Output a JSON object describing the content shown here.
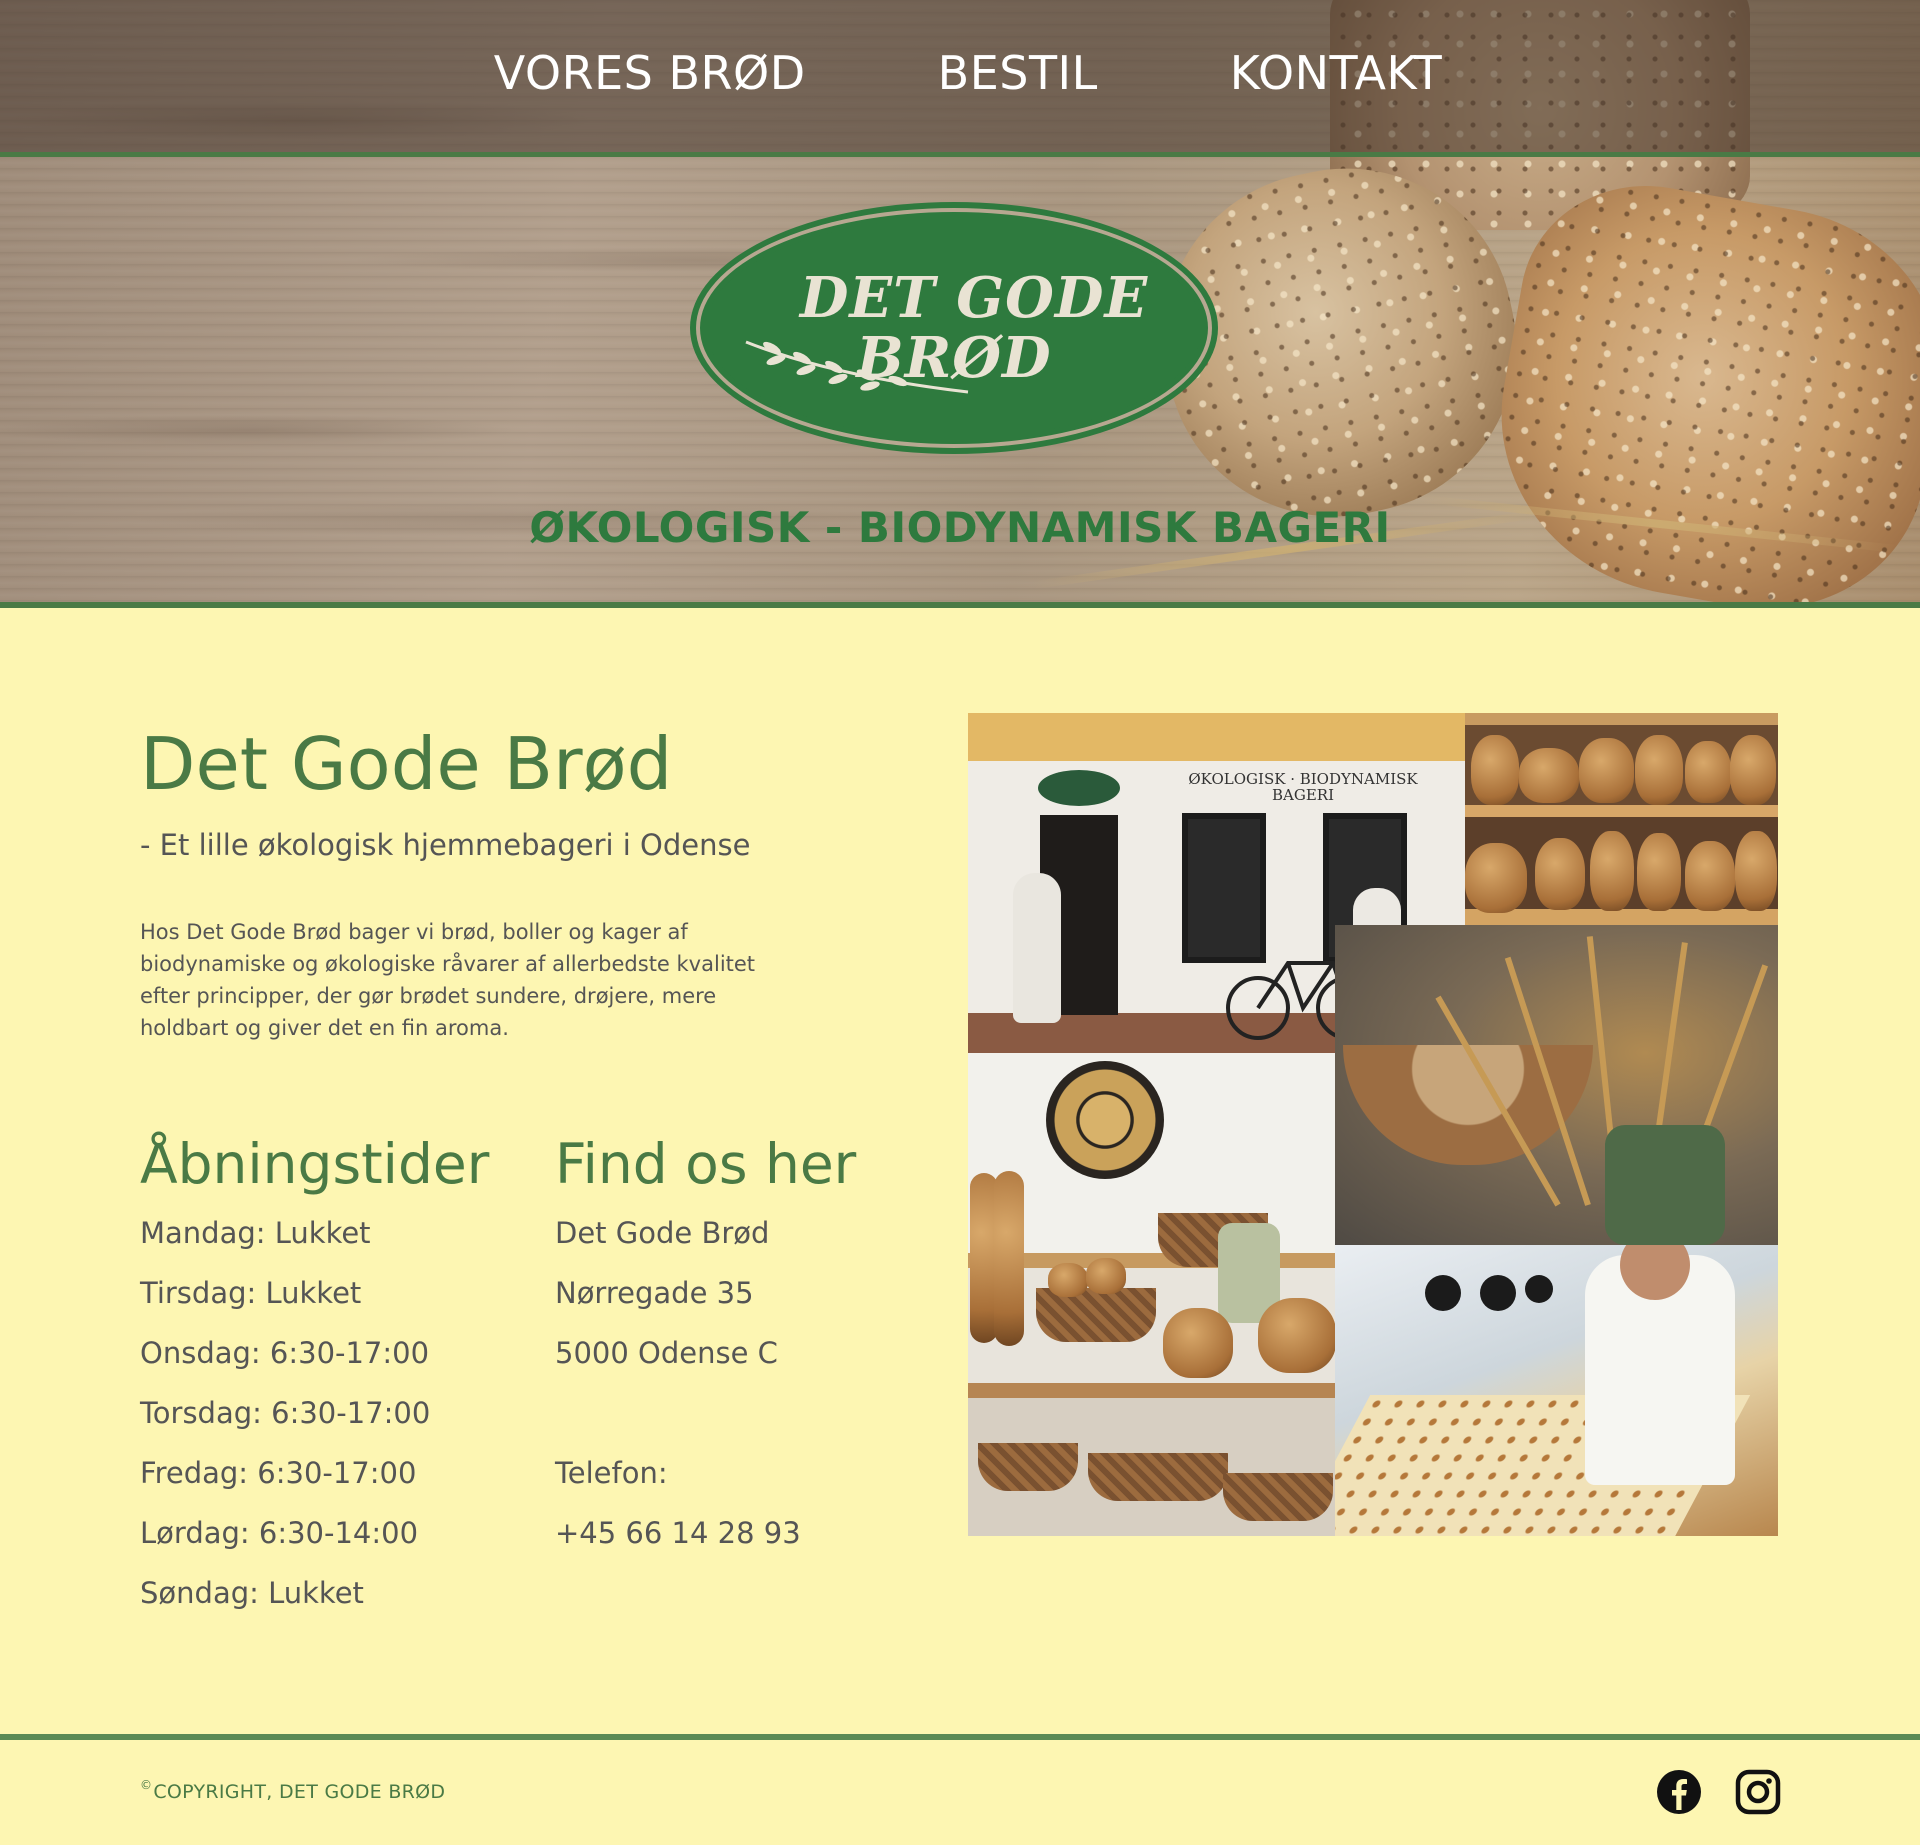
{
  "nav": {
    "items": [
      {
        "label": "VORES BRØD"
      },
      {
        "label": "BESTIL"
      },
      {
        "label": "KONTAKT"
      }
    ]
  },
  "hero": {
    "logo_line_1": "DET GODE",
    "logo_line_2": "BRØD",
    "tagline": "ØKOLOGISK - BIODYNAMISK BAGERI",
    "accent_color": "#2e7a3e"
  },
  "main": {
    "title": "Det Gode Brød",
    "subtitle": "- Et lille økologisk hjemmebageri i Odense",
    "intro": "Hos Det Gode Brød bager vi brød, boller og kager af biodynamiske og økologiske råvarer af allerbedste kvalitet efter principper, der gør brødet sundere, drøjere, mere holdbart og giver det en fin aroma."
  },
  "hours": {
    "heading": "Åbningstider",
    "days": [
      "Mandag: Lukket",
      "Tirsdag: Lukket",
      "Onsdag: 6:30-17:00",
      "Torsdag: 6:30-17:00",
      "Fredag: 6:30-17:00",
      "Lørdag: 6:30-14:00",
      "Søndag: Lukket"
    ]
  },
  "contact": {
    "heading": "Find os her",
    "name": "Det Gode Brød",
    "street": "Nørregade 35",
    "city": "5000 Odense C",
    "phone_label": "Telefon:",
    "phone": "+45 66 14 28 93"
  },
  "collage": {
    "shop_sign_text": "ØKOLOGISK · BIODYNAMISK BAGERI"
  },
  "footer": {
    "copyright_mark": "©",
    "copyright": "COPYRIGHT, DET GODE BRØD",
    "social_icons": [
      "facebook-icon",
      "instagram-icon"
    ]
  },
  "colors": {
    "background": "#fdf6b2",
    "green": "#4a7a45",
    "text": "#555555"
  }
}
